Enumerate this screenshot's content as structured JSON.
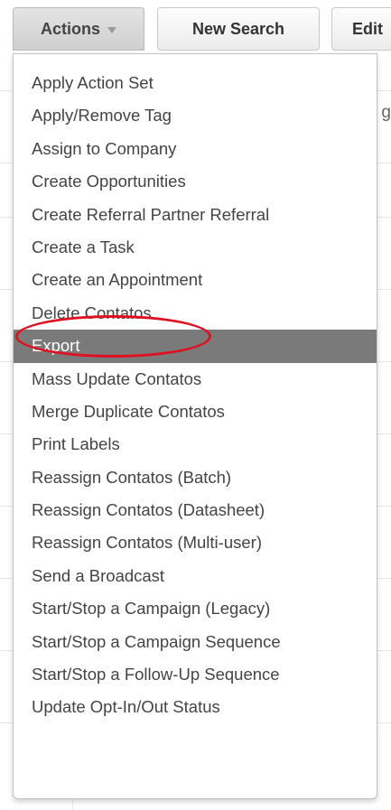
{
  "toolbar": {
    "actions_label": "Actions",
    "new_search_label": "New Search",
    "edit_label": "Edit"
  },
  "background": {
    "partial_text": "g"
  },
  "menu": {
    "items": [
      {
        "label": "Apply Action Set"
      },
      {
        "label": "Apply/Remove Tag"
      },
      {
        "label": "Assign to Company"
      },
      {
        "label": "Create Opportunities"
      },
      {
        "label": "Create Referral Partner Referral"
      },
      {
        "label": "Create a Task"
      },
      {
        "label": "Create an Appointment"
      },
      {
        "label": "Delete Contatos"
      },
      {
        "label": "Export"
      },
      {
        "label": "Mass Update Contatos"
      },
      {
        "label": "Merge Duplicate Contatos"
      },
      {
        "label": "Print Labels"
      },
      {
        "label": "Reassign Contatos (Batch)"
      },
      {
        "label": "Reassign Contatos (Datasheet)"
      },
      {
        "label": "Reassign Contatos (Multi-user)"
      },
      {
        "label": "Send a Broadcast"
      },
      {
        "label": "Start/Stop a Campaign (Legacy)"
      },
      {
        "label": "Start/Stop a Campaign Sequence"
      },
      {
        "label": "Start/Stop a Follow-Up Sequence"
      },
      {
        "label": "Update Opt-In/Out Status"
      }
    ],
    "hovered_item": "Export",
    "circled_item": "Delete Contatos"
  },
  "colors": {
    "hover_background": "#7a7a7a",
    "annotation_circle": "#e01020"
  },
  "icons": {
    "actions_caret": "chevron-down-icon"
  }
}
